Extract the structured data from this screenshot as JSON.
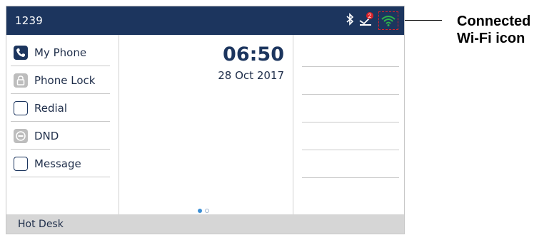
{
  "status_bar": {
    "extension": "1239",
    "icons": [
      "bluetooth-icon",
      "missed-call-icon",
      "wifi-icon"
    ],
    "missed_badge": "2",
    "colors": {
      "background": "#1c355e",
      "wifi": "#2fb34a",
      "highlight": "#d9232a"
    }
  },
  "programmable_keys": [
    {
      "label": "My Phone",
      "icon": "phone-icon"
    },
    {
      "label": "Phone Lock",
      "icon": "lock-icon"
    },
    {
      "label": "Redial",
      "icon": "empty-key-icon"
    },
    {
      "label": "DND",
      "icon": "dnd-icon"
    },
    {
      "label": "Message",
      "icon": "empty-key-icon"
    }
  ],
  "home": {
    "time": "06:50",
    "date": "28 Oct 2017",
    "page_index": 1,
    "page_count": 2
  },
  "softkeys": {
    "hot_desk": "Hot Desk"
  },
  "callout": {
    "line1": "Connected",
    "line2": "Wi-Fi icon"
  }
}
